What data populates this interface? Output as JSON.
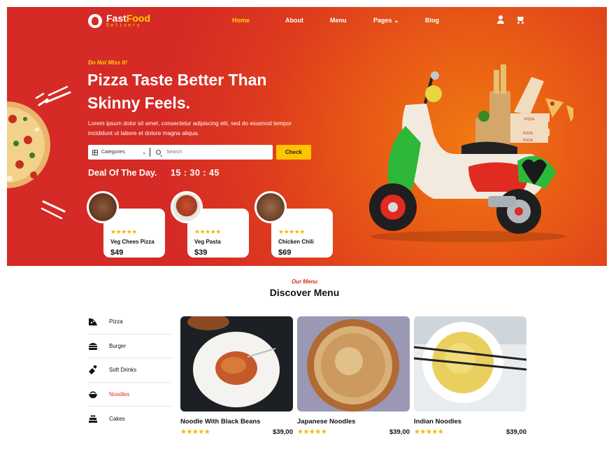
{
  "brand": {
    "name_a": "Fast",
    "name_b": "Food",
    "tagline": "Delivery",
    "accent": "#ffd400",
    "hero_red": "#d52a25"
  },
  "nav": {
    "items": [
      {
        "label": "Home",
        "active": true
      },
      {
        "label": "About"
      },
      {
        "label": "Menu"
      },
      {
        "label": "Pages"
      },
      {
        "label": "Blog"
      }
    ],
    "pages_chevron": "⌄",
    "icons": [
      "user-icon",
      "cart-icon"
    ]
  },
  "hero": {
    "tag": "Do Not Miss It!",
    "title": "Pizza Taste Better Than Skinny Feels.",
    "description": "Lorem ipsum dolor sit amet, consectetur adipiscing elit, sed do eiusmod tempor incididunt ut labore et dolore magna aliqua.",
    "search": {
      "category": "Categories",
      "placeholder": "Search",
      "button": "Check"
    },
    "deal_label": "Deal Of The Day.",
    "countdown": "15 : 30 : 45"
  },
  "deals": [
    {
      "name": "Veg Chees Pizza",
      "price": "$49",
      "rating": 5,
      "stars": "★★★★★"
    },
    {
      "name": "Veg Pasta",
      "price": "$39",
      "rating": 5,
      "stars": "★★★★★"
    },
    {
      "name": "Chicken Chili",
      "price": "$69",
      "rating": 5,
      "stars": "★★★★★"
    }
  ],
  "menu_section": {
    "tag": "Our Menu",
    "title": "Discover Menu",
    "categories": [
      {
        "label": "Pizza",
        "icon": "pizza-icon"
      },
      {
        "label": "Burger",
        "icon": "burger-icon"
      },
      {
        "label": "Soft Drinks",
        "icon": "bottle-icon"
      },
      {
        "label": "Noodles",
        "icon": "bowl-icon",
        "active": true
      },
      {
        "label": "Cakes",
        "icon": "cake-icon"
      }
    ],
    "products": [
      {
        "name": "Noodle With Black Beans",
        "price": "$39,00",
        "rating": 5,
        "stars": "★★★★★"
      },
      {
        "name": "Japanese Noodles",
        "price": "$39,00",
        "rating": 5,
        "stars": "★★★★★"
      },
      {
        "name": "Indian Noodles",
        "price": "$39,00",
        "rating": 5,
        "stars": "★★★★★"
      }
    ]
  }
}
